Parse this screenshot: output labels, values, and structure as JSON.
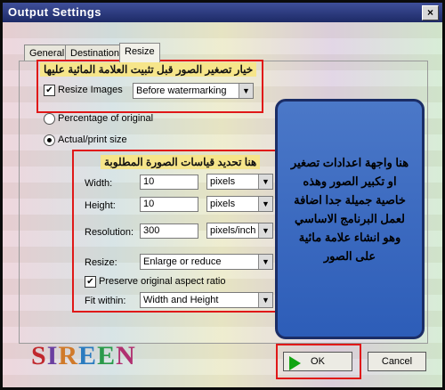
{
  "window": {
    "title": "Output Settings",
    "close_glyph": "×"
  },
  "tabs": [
    {
      "label": "General",
      "active": false
    },
    {
      "label": "Destination",
      "active": false
    },
    {
      "label": "Resize",
      "active": true
    }
  ],
  "annotations": {
    "top": "خيار تصغير الصور قبل تثبيت العلامة المائية عليها",
    "middle": "هنا تحديد قياسات الصورة المطلوبة",
    "info_lines": [
      "هنا واجهة اعدادات تصغير",
      "او تكبير الصور وهذه",
      "خاصية جميلة جدا اضافة",
      "لعمل البرنامج الاساسي",
      "وهو انشاء علامة مائية",
      "على الصور"
    ]
  },
  "resize_images": {
    "label": "Resize Images",
    "checked": true,
    "mode": "Before watermarking"
  },
  "options": {
    "percentage": "Percentage of original",
    "actual": "Actual/print size",
    "selected": "actual"
  },
  "fields": {
    "width": {
      "label": "Width:",
      "value": "10",
      "unit": "pixels"
    },
    "height": {
      "label": "Height:",
      "value": "10",
      "unit": "pixels"
    },
    "resolution": {
      "label": "Resolution:",
      "value": "300",
      "unit": "pixels/inch"
    },
    "resize": {
      "label": "Resize:",
      "value": "Enlarge or reduce"
    },
    "aspect": {
      "label": "Preserve original aspect ratio",
      "checked": true
    },
    "fit": {
      "label": "Fit within:",
      "value": "Width and Height"
    }
  },
  "logo": {
    "letters": [
      "S",
      "I",
      "R",
      "E",
      "E",
      "N"
    ],
    "colors": [
      "#c0282d",
      "#6b3fa0",
      "#d07a2a",
      "#2a7bbf",
      "#2a9a4a",
      "#b03070"
    ]
  },
  "buttons": {
    "ok": "OK",
    "cancel": "Cancel"
  },
  "check_glyph": "✔",
  "dropdown_glyph": "▼"
}
